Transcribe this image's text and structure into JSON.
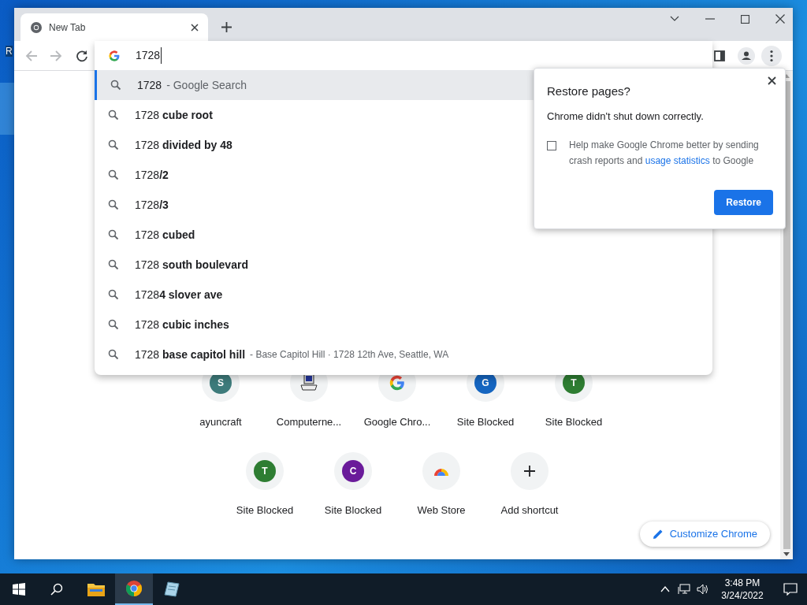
{
  "desktop": {
    "icon_label": "R"
  },
  "tab": {
    "title": "New Tab",
    "selected": true
  },
  "omnibox": {
    "value": "1728"
  },
  "suggestions": [
    {
      "text": "1728",
      "detail": "- Google Search",
      "selected": true
    },
    {
      "text": "1728 **cube root**",
      "selected": false
    },
    {
      "text": "1728 **divided by 48**",
      "selected": false
    },
    {
      "text": "1728**/2**",
      "selected": false
    },
    {
      "text": "1728**/3**",
      "selected": false
    },
    {
      "text": "1728 **cubed**",
      "selected": false
    },
    {
      "text": "1728 **south boulevard**",
      "selected": false
    },
    {
      "text": "1728**4 slover ave**",
      "selected": false
    },
    {
      "text": "1728 **cubic inches**",
      "selected": false
    },
    {
      "text": "1728 **base capitol hill**",
      "detail": "- Base Capitol Hill · 1728 12th Ave, Seattle, WA",
      "selected": false
    }
  ],
  "restore_dialog": {
    "title": "Restore pages?",
    "message": "Chrome didn't shut down correctly.",
    "checkbox": {
      "checked": false,
      "text_before": "Help make Google Chrome better by sending crash reports and",
      "link": "usage statistics",
      "text_after": "to Google"
    },
    "button": "Restore"
  },
  "shortcuts": [
    {
      "kind": "letter",
      "letter": "S",
      "color": "#3d7b7b",
      "label": "ayuncraft"
    },
    {
      "kind": "computer",
      "label": "Computerne..."
    },
    {
      "kind": "google",
      "label": "Google Chro..."
    },
    {
      "kind": "letter",
      "letter": "G",
      "color": "#1565c0",
      "label": "Site Blocked"
    },
    {
      "kind": "letter",
      "letter": "T",
      "color": "#2e7d32",
      "label": "Site Blocked"
    },
    {
      "kind": "letter",
      "letter": "T",
      "color": "#2e7d32",
      "label": "Site Blocked"
    },
    {
      "kind": "letter",
      "letter": "C",
      "color": "#6a1b9a",
      "label": "Site Blocked"
    },
    {
      "kind": "webstore",
      "label": "Web Store"
    },
    {
      "kind": "add",
      "label": "Add shortcut"
    }
  ],
  "customize_button": "Customize Chrome",
  "taskbar": {
    "apps": [
      {
        "kind": "explorer",
        "selected": false
      },
      {
        "kind": "chrome",
        "selected": true
      },
      {
        "kind": "notes",
        "selected": false
      }
    ],
    "time": "3:48 PM",
    "date": "3/24/2022"
  }
}
